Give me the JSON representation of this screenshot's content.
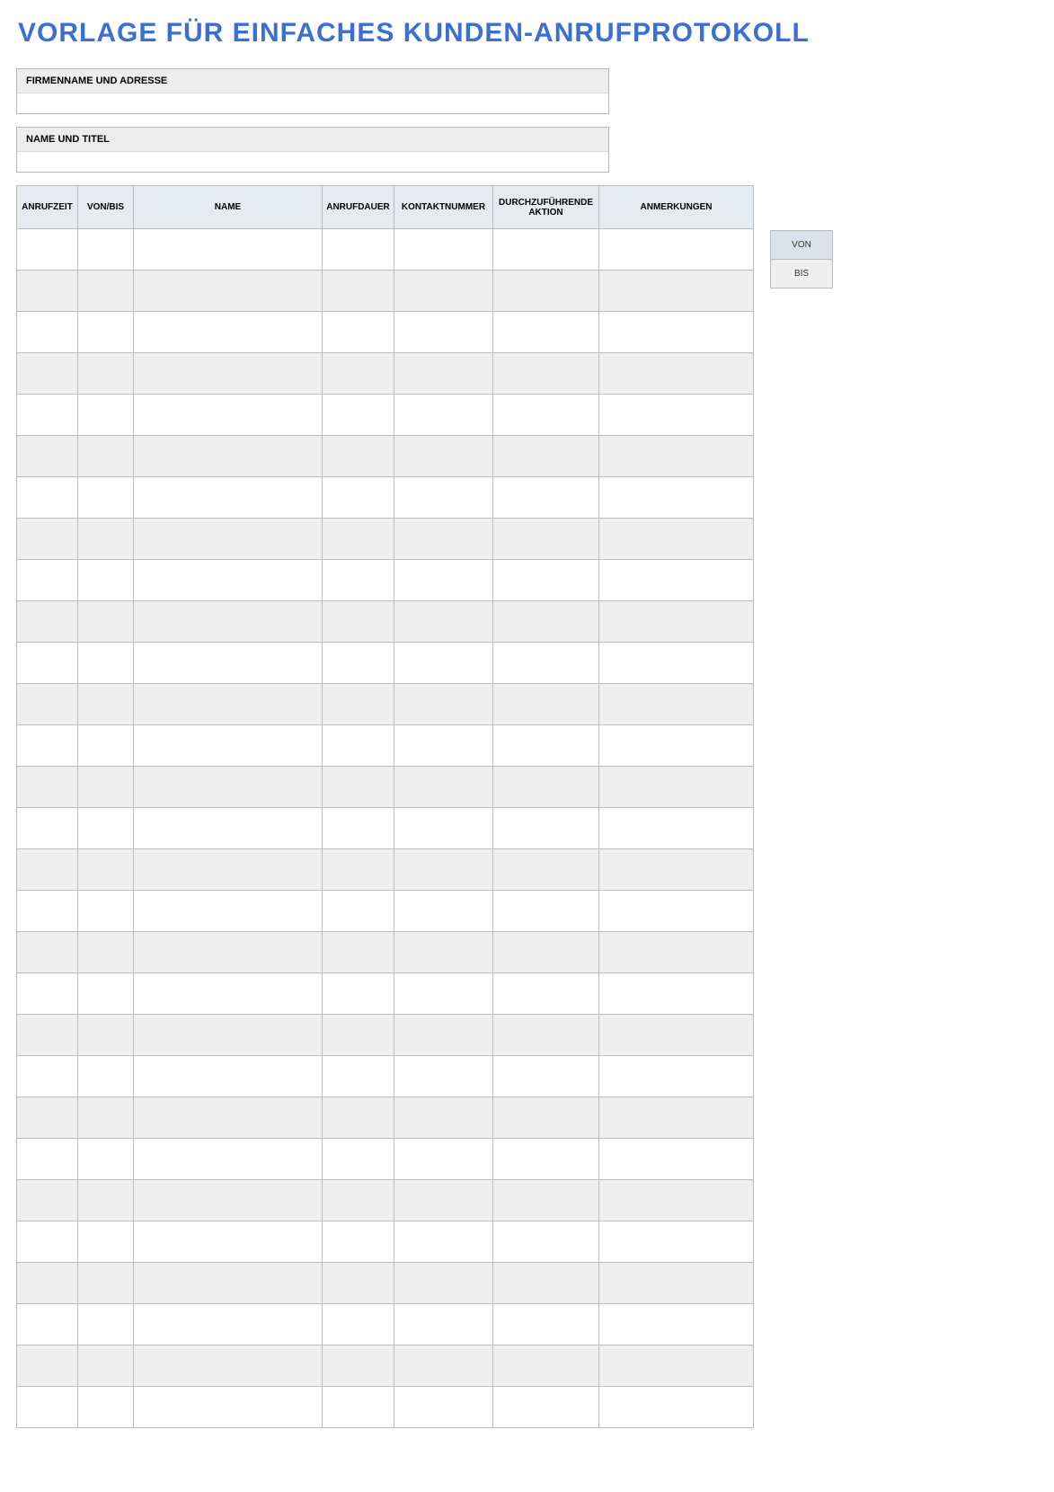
{
  "title": "VORLAGE FÜR EINFACHES KUNDEN-ANRUFPROTOKOLL",
  "info": {
    "company_label": "FIRMENNAME UND ADRESSE",
    "company_value": "",
    "name_label": "NAME UND TITEL",
    "name_value": ""
  },
  "columns": {
    "time": "ANRUFZEIT",
    "direction": "VON/BIS",
    "name": "NAME",
    "duration": "ANRUFDAUER",
    "contact": "KONTAKTNUMMER",
    "action": "DURCHZUFÜHRENDE AKTION",
    "notes": "ANMERKUNGEN"
  },
  "legend": {
    "from": "VON",
    "to": "BIS"
  },
  "row_count": 29
}
